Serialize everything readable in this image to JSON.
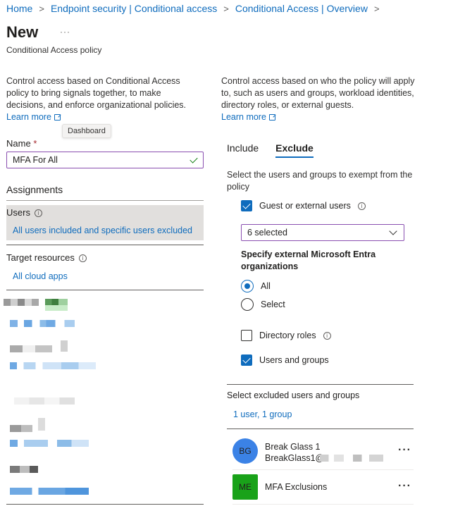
{
  "breadcrumb": {
    "items": [
      "Home",
      "Endpoint security | Conditional access",
      "Conditional Access | Overview"
    ],
    "separator": ">"
  },
  "page": {
    "title": "New",
    "more": "···",
    "subtitle": "Conditional Access policy"
  },
  "left": {
    "description": "Control access based on Conditional Access policy to bring signals together, to make decisions, and enforce organizational policies.",
    "learn_more": "Learn more",
    "tooltip": "Dashboard",
    "name_label": "Name",
    "required_mark": "*",
    "name_value": "MFA For All",
    "assignments_heading": "Assignments",
    "users_label": "Users",
    "users_value": "All users included and specific users excluded",
    "target_label": "Target resources",
    "target_value": "All cloud apps",
    "info_glyph": "i"
  },
  "right": {
    "description": "Control access based on who the policy will apply to, such as users and groups, workload identities, directory roles, or external guests.",
    "learn_more": "Learn more",
    "tabs": [
      {
        "label": "Include",
        "active": false
      },
      {
        "label": "Exclude",
        "active": true
      }
    ],
    "exempt_text": "Select the users and groups to exempt from the policy",
    "guest_label": "Guest or external users",
    "guest_checked": true,
    "guest_select_value": "6 selected",
    "specify_heading": "Specify external Microsoft Entra organizations",
    "radio_all": "All",
    "radio_select": "Select",
    "radio_selected": "All",
    "directory_roles_label": "Directory roles",
    "directory_roles_checked": false,
    "users_groups_label": "Users and groups",
    "users_groups_checked": true,
    "excluded_heading": "Select excluded users and groups",
    "excluded_summary": "1 user, 1 group",
    "members": [
      {
        "initials": "BG",
        "name": "Break Glass 1",
        "email": "BreakGlass1@",
        "avatar_color": "#3b82e6",
        "more": "···"
      },
      {
        "initials": "ME",
        "name": "MFA Exclusions",
        "email": "",
        "avatar_color": "#19a219",
        "more": "···"
      }
    ]
  },
  "colors": {
    "link": "#0f6cbd",
    "focus_border": "#8a4fb0",
    "selected_row": "#e1dfdd",
    "check_green": "#107c10"
  }
}
